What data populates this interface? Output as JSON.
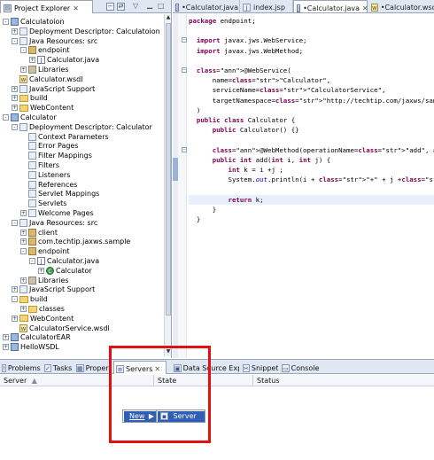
{
  "explorer": {
    "title": "Project Explorer",
    "tree": [
      {
        "depth": 0,
        "label": "Calculatoion",
        "icon": "project-icon",
        "expanded": "-"
      },
      {
        "depth": 1,
        "label": "Deployment Descriptor: Calculatoion",
        "icon": "descriptor-icon",
        "expanded": "+"
      },
      {
        "depth": 1,
        "label": "Java Resources: src",
        "icon": "java-resources-icon",
        "expanded": "-"
      },
      {
        "depth": 2,
        "label": "endpoint",
        "icon": "package-icon",
        "expanded": "-"
      },
      {
        "depth": 3,
        "label": "Calculator.java",
        "icon": "java-file-icon",
        "expanded": "+"
      },
      {
        "depth": 2,
        "label": "Libraries",
        "icon": "library-icon",
        "expanded": "+"
      },
      {
        "depth": 1,
        "label": "Calculator.wsdl",
        "icon": "wsdl-icon",
        "expanded": ""
      },
      {
        "depth": 1,
        "label": "JavaScript Support",
        "icon": "js-support-icon",
        "expanded": "+"
      },
      {
        "depth": 1,
        "label": "build",
        "icon": "folder-icon",
        "expanded": "+"
      },
      {
        "depth": 1,
        "label": "WebContent",
        "icon": "folder-icon",
        "expanded": "+"
      },
      {
        "depth": 0,
        "label": "Calculator",
        "icon": "project-icon",
        "expanded": "-"
      },
      {
        "depth": 1,
        "label": "Deployment Descriptor: Calculator",
        "icon": "descriptor-icon",
        "expanded": "-"
      },
      {
        "depth": 2,
        "label": "Context Parameters",
        "icon": "context-params-icon",
        "expanded": ""
      },
      {
        "depth": 2,
        "label": "Error Pages",
        "icon": "error-pages-icon",
        "expanded": ""
      },
      {
        "depth": 2,
        "label": "Filter Mappings",
        "icon": "filter-mappings-icon",
        "expanded": ""
      },
      {
        "depth": 2,
        "label": "Filters",
        "icon": "filters-icon",
        "expanded": ""
      },
      {
        "depth": 2,
        "label": "Listeners",
        "icon": "listeners-icon",
        "expanded": ""
      },
      {
        "depth": 2,
        "label": "References",
        "icon": "references-icon",
        "expanded": ""
      },
      {
        "depth": 2,
        "label": "Servlet Mappings",
        "icon": "servlet-mappings-icon",
        "expanded": ""
      },
      {
        "depth": 2,
        "label": "Servlets",
        "icon": "servlets-icon",
        "expanded": ""
      },
      {
        "depth": 2,
        "label": "Welcome Pages",
        "icon": "welcome-pages-icon",
        "expanded": "+"
      },
      {
        "depth": 1,
        "label": "Java Resources: src",
        "icon": "java-resources-icon",
        "expanded": "-"
      },
      {
        "depth": 2,
        "label": "client",
        "icon": "package-icon",
        "expanded": "+"
      },
      {
        "depth": 2,
        "label": "com.techtip.jaxws.sample",
        "icon": "package-icon",
        "expanded": "+"
      },
      {
        "depth": 2,
        "label": "endpoint",
        "icon": "package-icon",
        "expanded": "-"
      },
      {
        "depth": 3,
        "label": "Calculator.java",
        "icon": "java-file-icon",
        "expanded": "-"
      },
      {
        "depth": 4,
        "label": "Calculator",
        "icon": "class-icon",
        "expanded": "+"
      },
      {
        "depth": 2,
        "label": "Libraries",
        "icon": "library-icon",
        "expanded": "+"
      },
      {
        "depth": 1,
        "label": "JavaScript Support",
        "icon": "js-support-icon",
        "expanded": "+"
      },
      {
        "depth": 1,
        "label": "build",
        "icon": "folder-icon",
        "expanded": "-"
      },
      {
        "depth": 2,
        "label": "classes",
        "icon": "folder-icon",
        "expanded": "+"
      },
      {
        "depth": 1,
        "label": "WebContent",
        "icon": "folder-icon",
        "expanded": "+"
      },
      {
        "depth": 1,
        "label": "CalculatorService.wsdl",
        "icon": "wsdl-icon",
        "expanded": ""
      },
      {
        "depth": 0,
        "label": "CalculatorEAR",
        "icon": "ear-project-icon",
        "expanded": "+"
      },
      {
        "depth": 0,
        "label": "HelloWSDL",
        "icon": "project-icon",
        "expanded": "+"
      }
    ]
  },
  "editor": {
    "tabs": [
      {
        "label": "•Calculator.java",
        "active": false
      },
      {
        "label": "index.jsp",
        "active": false
      },
      {
        "label": "•Calculator.java",
        "active": true
      },
      {
        "label": "•Calculator.wsdl",
        "active": false
      }
    ],
    "code": [
      "package endpoint;",
      "",
      "  import javax.jws.WebService;",
      "  import javax.jws.WebMethod;",
      "",
      "  @WebService(",
      "      name=\"Calculator\",",
      "      serviceName=\"CalculatorService\",",
      "      targetNamespace=\"http://techtip.com/jaxws/sample\"",
      "  )",
      "  public class Calculator {",
      "      public Calculator() {}",
      "",
      "      @WebMethod(operationName=\"add\", action=\"urn:Add\")",
      "      public int add(int i, int j) {",
      "          int k = i +j ;",
      "          System.out.println(i + \"+\" + j +\" = \" + k);",
      "",
      "          return k;",
      "      }",
      "  }"
    ]
  },
  "bottom": {
    "tabs": [
      {
        "label": "Problems",
        "icon": "problems-icon"
      },
      {
        "label": "Tasks",
        "icon": "tasks-icon"
      },
      {
        "label": "Properties",
        "icon": "properties-icon"
      },
      {
        "label": "Servers",
        "icon": "servers-icon"
      },
      {
        "label": "Data Source Explorer",
        "icon": "data-source-icon"
      },
      {
        "label": "Snippets",
        "icon": "snippets-icon"
      },
      {
        "label": "Console",
        "icon": "console-icon"
      }
    ],
    "columns": {
      "server": "Server",
      "state": "State",
      "status": "Status"
    }
  },
  "context_menu": {
    "new_label": "New",
    "server_label": "Server"
  },
  "colors": {
    "highlight": "#e21111",
    "keyword": "#7f0055",
    "string": "#2a00ff",
    "menu_selection": "#2f5fb5"
  }
}
